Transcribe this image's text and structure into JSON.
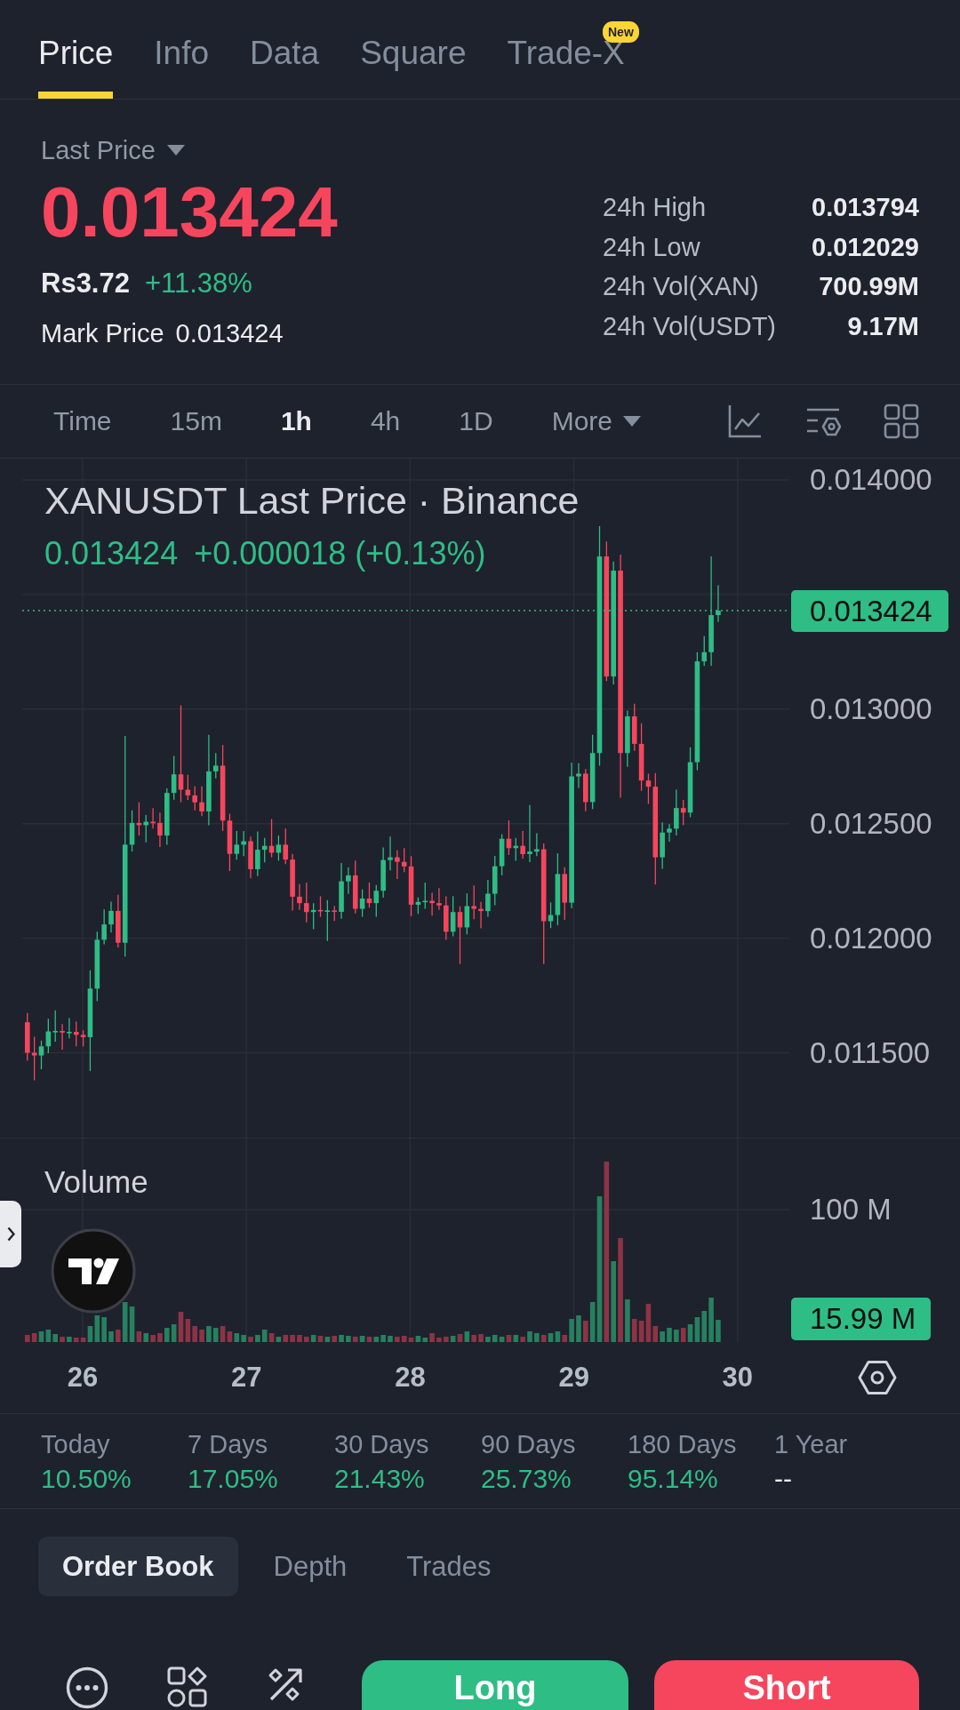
{
  "tabs": [
    {
      "label": "Price",
      "selected": true
    },
    {
      "label": "Info",
      "selected": false
    },
    {
      "label": "Data",
      "selected": false
    },
    {
      "label": "Square",
      "selected": false
    },
    {
      "label": "Trade-X",
      "selected": false,
      "badge": "New"
    }
  ],
  "price_header": {
    "price_type": "Last Price",
    "last_price": "0.013424",
    "fiat_price": "Rs3.72",
    "change_percent": "+11.38%",
    "mark_price_label": "Mark Price",
    "mark_price": "0.013424",
    "stats": [
      {
        "label": "24h High",
        "value": "0.013794"
      },
      {
        "label": "24h Low",
        "value": "0.012029"
      },
      {
        "label": "24h Vol(XAN)",
        "value": "700.99M"
      },
      {
        "label": "24h Vol(USDT)",
        "value": "9.17M"
      }
    ]
  },
  "timeframes": [
    {
      "label": "Time",
      "selected": false
    },
    {
      "label": "15m",
      "selected": false
    },
    {
      "label": "1h",
      "selected": true
    },
    {
      "label": "4h",
      "selected": false
    },
    {
      "label": "1D",
      "selected": false
    }
  ],
  "more_menu": {
    "label": "More"
  },
  "chart": {
    "title": "XANUSDT Last Price · Binance",
    "legend_price": "0.013424",
    "legend_change": "+0.000018 (+0.13%)",
    "price_axis": [
      "0.014000",
      "0.013000",
      "0.012500",
      "0.012000",
      "0.011500"
    ],
    "last_price_tag": "0.013424",
    "volume_label": "Volume",
    "volume_axis": [
      "100 M"
    ],
    "volume_tag": "15.99 M",
    "date_axis": [
      "26",
      "27",
      "28",
      "29",
      "30"
    ]
  },
  "performance": [
    {
      "label": "Today",
      "value": "10.50%",
      "color": "#2ebd85"
    },
    {
      "label": "7 Days",
      "value": "17.05%",
      "color": "#2ebd85"
    },
    {
      "label": "30 Days",
      "value": "21.43%",
      "color": "#2ebd85"
    },
    {
      "label": "90 Days",
      "value": "25.73%",
      "color": "#2ebd85"
    },
    {
      "label": "180 Days",
      "value": "95.14%",
      "color": "#2ebd85"
    },
    {
      "label": "1 Year",
      "value": "--",
      "color": "#eaecef"
    }
  ],
  "order_tabs": [
    {
      "label": "Order Book",
      "selected": true
    },
    {
      "label": "Depth",
      "selected": false
    },
    {
      "label": "Trades",
      "selected": false
    }
  ],
  "actions": [
    {
      "label": "Long",
      "kind": "long"
    },
    {
      "label": "Short",
      "kind": "short"
    }
  ]
}
